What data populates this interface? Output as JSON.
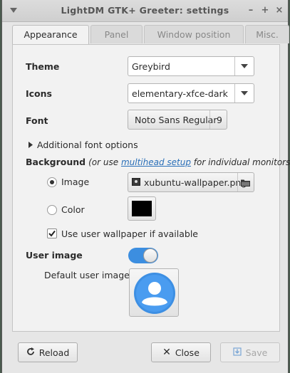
{
  "window": {
    "title": "LightDM GTK+ Greeter: settings",
    "controls": {
      "minimize": "–",
      "maximize": "+",
      "close": "×"
    }
  },
  "tabs": [
    {
      "label": "Appearance",
      "active": true
    },
    {
      "label": "Panel"
    },
    {
      "label": "Window position"
    },
    {
      "label": "Misc."
    }
  ],
  "appearance": {
    "theme_label": "Theme",
    "theme_value": "Greybird",
    "icons_label": "Icons",
    "icons_value": "elementary-xfce-dark",
    "font_label": "Font",
    "font_name": "Noto Sans Regular",
    "font_size": "9",
    "additional_font_options": "Additional font options",
    "background_label": "Background",
    "background_hint_prefix": "(or use ",
    "background_hint_link": "multihead setup",
    "background_hint_suffix": " for individual monitors)",
    "image_option": "Image",
    "image_file": "xubuntu-wallpaper.png",
    "color_option": "Color",
    "color_value": "#000000",
    "use_user_wallpaper": "Use user wallpaper if available",
    "use_user_wallpaper_checked": true,
    "user_image_label": "User image",
    "user_image_enabled": true,
    "default_user_image_label": "Default user image"
  },
  "footer": {
    "reload": "Reload",
    "close": "Close",
    "save": "Save"
  },
  "colors": {
    "accent": "#3c8ee0",
    "link": "#2a6fb8"
  }
}
